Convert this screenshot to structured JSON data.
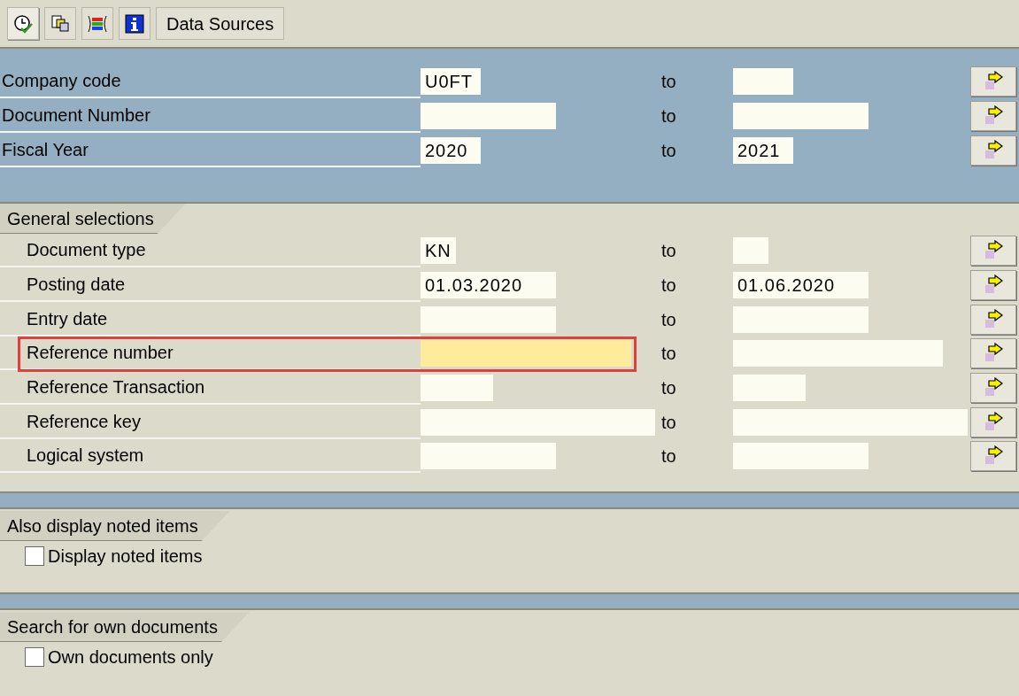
{
  "toolbar": {
    "buttons": [
      {
        "kind": "execute"
      },
      {
        "kind": "copy"
      },
      {
        "kind": "selections"
      },
      {
        "kind": "info"
      },
      {
        "kind": "text",
        "label": "Data Sources"
      }
    ]
  },
  "top_fields": [
    {
      "label": "Company code",
      "low": "U0FT",
      "to": "to",
      "highlighted": false
    },
    {
      "label": "Document Number",
      "to": "to",
      "highlighted": false
    },
    {
      "label": "Fiscal Year",
      "low": "2020",
      "to": "to",
      "high": "2021",
      "highlighted": false
    }
  ],
  "general_selections": {
    "title": "General selections",
    "fields": [
      {
        "label": "Document type",
        "low": "KN",
        "to": "to",
        "highlighted": false
      },
      {
        "label": "Posting date",
        "low": "01.03.2020",
        "to": "to",
        "high": "01.06.2020",
        "highlighted": false
      },
      {
        "label": "Entry date",
        "to": "to",
        "highlighted": false
      },
      {
        "label": "Reference number",
        "to": "to",
        "highlighted": true
      },
      {
        "label": "Reference Transaction",
        "to": "to",
        "highlighted": false
      },
      {
        "label": "Reference key",
        "to": "to",
        "highlighted": false
      },
      {
        "label": "Logical system",
        "to": "to",
        "highlighted": false
      }
    ]
  },
  "noted_items": {
    "title": "Also display noted items",
    "checkbox": {
      "label": "Display noted items",
      "checked": false
    }
  },
  "own_documents": {
    "title": "Search for own documents",
    "checkbox": {
      "label": "Own documents only",
      "checked": false
    }
  }
}
